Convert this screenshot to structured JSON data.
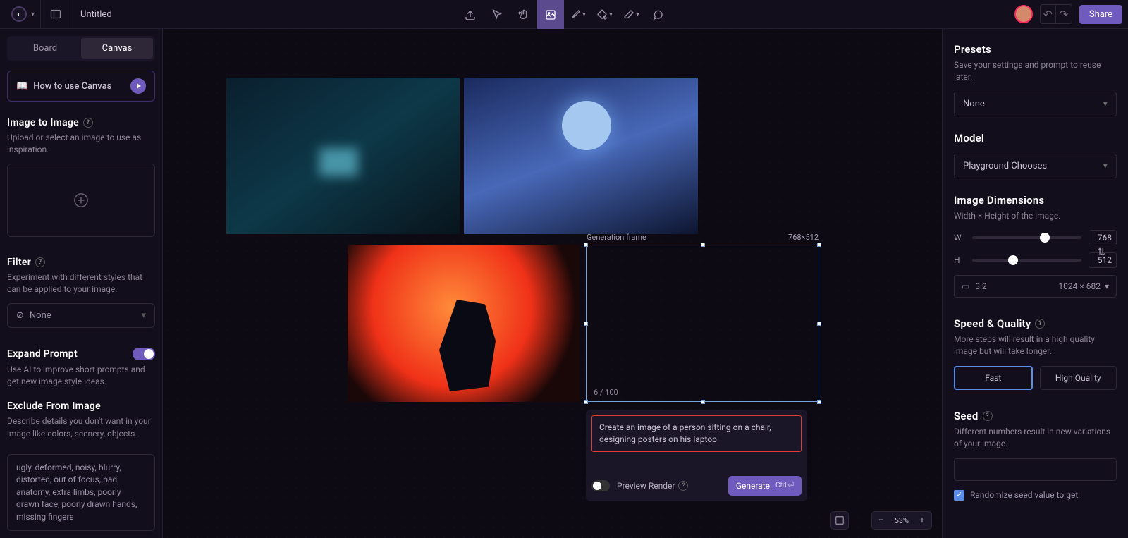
{
  "topbar": {
    "title": "Untitled",
    "share": "Share"
  },
  "subtabs": {
    "board": "Board",
    "canvas": "Canvas"
  },
  "howto": "How to use Canvas",
  "img2img": {
    "title": "Image to Image",
    "desc": "Upload or select an image to use as inspiration."
  },
  "filter": {
    "title": "Filter",
    "desc": "Experiment with different styles that can be applied to your image.",
    "value": "None"
  },
  "expand": {
    "title": "Expand Prompt",
    "desc": "Use AI to improve short prompts and get new image style ideas."
  },
  "exclude": {
    "title": "Exclude From Image",
    "desc": "Describe details you don't want in your image like colors, scenery, objects.",
    "value": "ugly, deformed, noisy, blurry, distorted, out of focus, bad anatomy, extra limbs, poorly drawn face, poorly drawn hands, missing fingers"
  },
  "genframe": {
    "label": "Generation frame",
    "size": "768×512",
    "count": "6 / 100"
  },
  "prompt": {
    "text": "Create an image of a person sitting on a chair, designing posters on his laptop",
    "preview": "Preview Render",
    "generate": "Generate",
    "kbd": "Ctrl"
  },
  "zoom": {
    "value": "53%"
  },
  "presets": {
    "title": "Presets",
    "desc": "Save your settings and prompt to reuse later.",
    "value": "None"
  },
  "model": {
    "title": "Model",
    "value": "Playground Chooses"
  },
  "dims": {
    "title": "Image Dimensions",
    "desc": "Width × Height of the image.",
    "w_label": "W",
    "w_val": "768",
    "h_label": "H",
    "h_val": "512",
    "aspect": "3:2",
    "effective": "1024 × 682"
  },
  "quality": {
    "title": "Speed & Quality",
    "desc": "More steps will result in a high quality image but will take longer.",
    "fast": "Fast",
    "high": "High Quality"
  },
  "seed": {
    "title": "Seed",
    "desc": "Different numbers result in new variations of your image.",
    "randomize": "Randomize seed value to get"
  }
}
